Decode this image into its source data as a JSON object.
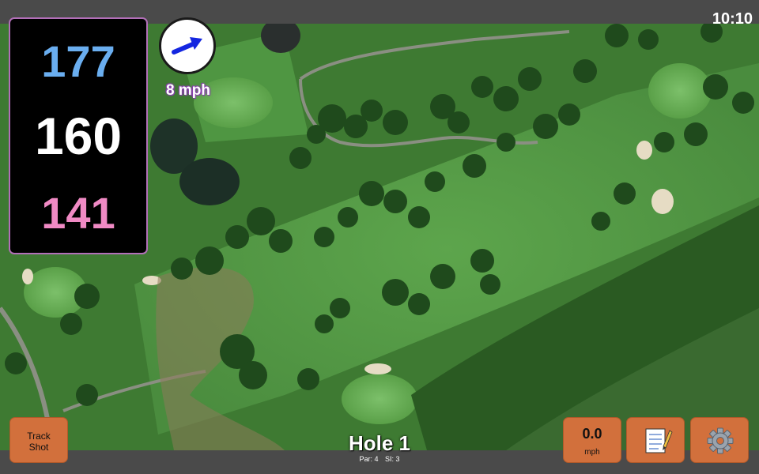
{
  "status": {
    "time": "10:10"
  },
  "distances": {
    "back": "177",
    "middle": "160",
    "front": "141",
    "colors": {
      "back": "#6aaef0",
      "middle": "#ffffff",
      "front": "#f08ac4"
    }
  },
  "wind": {
    "speed_label": "8 mph",
    "direction_icon": "arrow-icon",
    "arrow_color": "#1426e0"
  },
  "controls": {
    "track_shot": "Track Shot",
    "speed_value": "0.0",
    "speed_unit": "mph",
    "notes_icon": "notepad-icon",
    "settings_icon": "gear-icon"
  },
  "hole": {
    "title": "Hole 1",
    "par": "Par: 4",
    "si": "SI: 3"
  },
  "colors": {
    "button": "#d2703c",
    "panel_border": "#b26fb8",
    "bar": "#4a4a4a"
  }
}
